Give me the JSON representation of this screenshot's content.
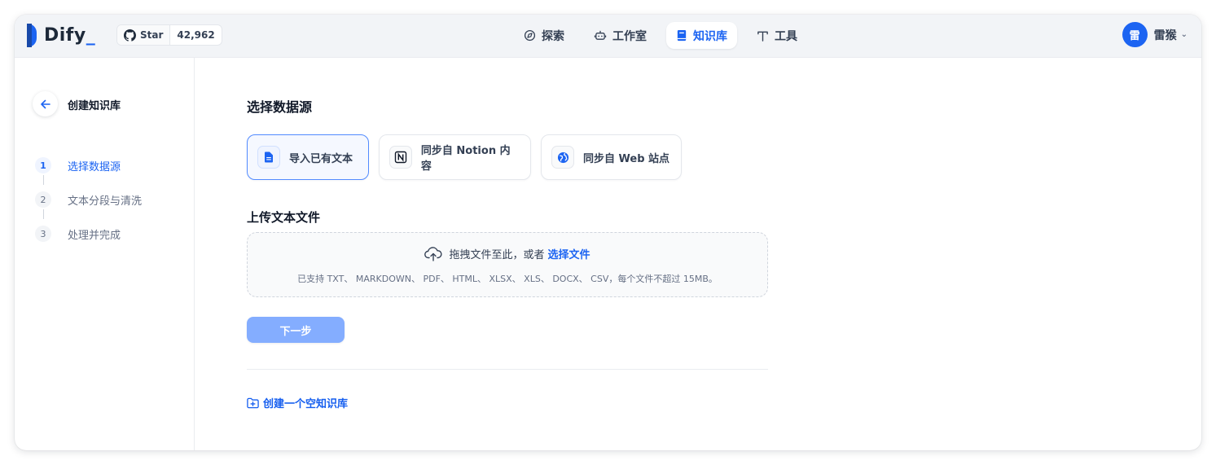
{
  "header": {
    "logo": {
      "text": "Dify",
      "accent": "_"
    },
    "github": {
      "label": "Star",
      "count": "42,962"
    },
    "nav": [
      {
        "label": "探索",
        "icon": "compass-icon",
        "active": false
      },
      {
        "label": "工作室",
        "icon": "robot-icon",
        "active": false
      },
      {
        "label": "知识库",
        "icon": "book-icon",
        "active": true
      },
      {
        "label": "工具",
        "icon": "hammer-icon",
        "active": false
      }
    ],
    "user": {
      "avatar_text": "雷",
      "name": "雷猴"
    }
  },
  "sidebar": {
    "title": "创建知识库",
    "steps": [
      {
        "num": "1",
        "label": "选择数据源",
        "active": true
      },
      {
        "num": "2",
        "label": "文本分段与清洗",
        "active": false
      },
      {
        "num": "3",
        "label": "处理并完成",
        "active": false
      }
    ]
  },
  "main": {
    "title": "选择数据源",
    "sources": [
      {
        "label": "导入已有文本",
        "icon": "file-icon",
        "active": true
      },
      {
        "label": "同步自 Notion 内容",
        "icon": "notion-icon",
        "active": false
      },
      {
        "label": "同步自 Web 站点",
        "icon": "web-icon",
        "active": false
      }
    ],
    "upload_title": "上传文本文件",
    "drop_text": "拖拽文件至此，或者",
    "drop_link": "选择文件",
    "drop_hint": "已支持 TXT、 MARKDOWN、 PDF、 HTML、 XLSX、 XLS、 DOCX、 CSV，每个文件不超过 15MB。",
    "next_label": "下一步",
    "create_empty_label": "创建一个空知识库"
  },
  "colors": {
    "primary": "#1c64f2",
    "primary_light": "#84adff",
    "header_bg": "#f2f4f7"
  }
}
